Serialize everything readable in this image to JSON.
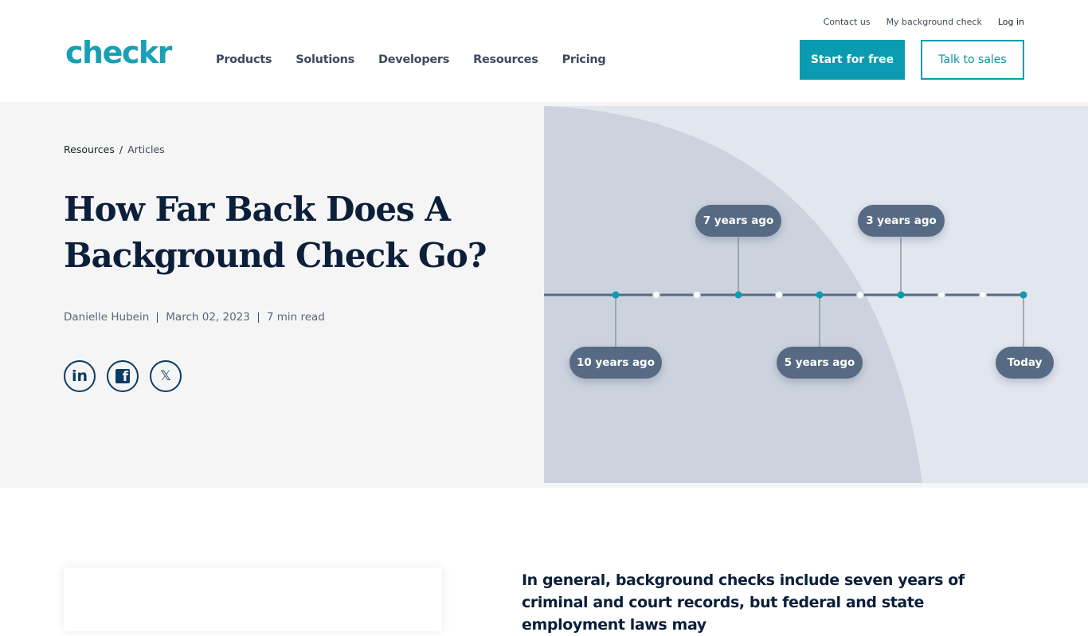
{
  "header": {
    "logo": "checkr",
    "nav": [
      "Products",
      "Solutions",
      "Developers",
      "Resources",
      "Pricing"
    ],
    "utility_links": [
      "Contact us",
      "My background check",
      "Log in"
    ],
    "start_button": "Start for free",
    "sales_button": "Talk to sales",
    "brand_color": "#0a9bb0"
  },
  "hero": {
    "breadcrumb": {
      "root": "Resources",
      "separator": "/",
      "current": "Articles"
    },
    "title": "How Far Back Does A Background Check Go?",
    "author": "Danielle Hubein",
    "date": "March 02, 2023",
    "read_time": "7 min read",
    "share": [
      {
        "icon": "linkedin-icon",
        "glyph": "in"
      },
      {
        "icon": "facebook-icon",
        "glyph": "f"
      },
      {
        "icon": "x-icon",
        "glyph": "𝕏"
      }
    ],
    "timeline": {
      "labels_top": [
        "7 years ago",
        "3 years ago"
      ],
      "labels_bottom": [
        "10 years ago",
        "5 years ago",
        "Today"
      ]
    }
  },
  "content": {
    "lead": "In general, background checks include seven years of criminal and court records, but federal and state employment laws may"
  }
}
